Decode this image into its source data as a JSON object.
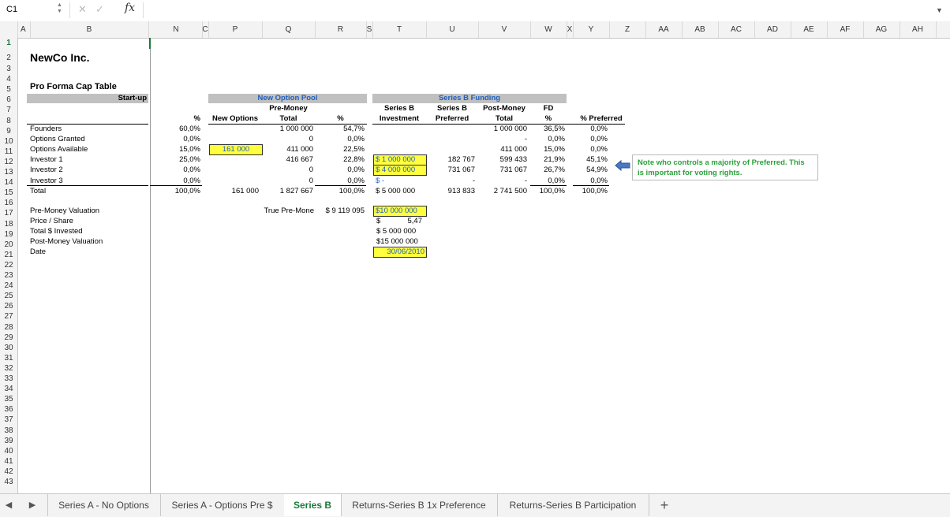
{
  "formula_bar": {
    "name_box": "C1",
    "fx": "fx",
    "formula": ""
  },
  "columns": [
    "A",
    "B",
    "N",
    "C",
    "P",
    "Q",
    "R",
    "S",
    "T",
    "U",
    "V",
    "W",
    "X",
    "Y",
    "Z",
    "AA",
    "AB",
    "AC",
    "AD",
    "AE",
    "AF",
    "AG",
    "AH"
  ],
  "rows": [
    "1",
    "2",
    "3",
    "4",
    "5",
    "6",
    "7",
    "8",
    "9",
    "10",
    "11",
    "12",
    "13",
    "14",
    "15",
    "16",
    "17",
    "18",
    "19",
    "20",
    "21",
    "22",
    "23",
    "24",
    "25",
    "26",
    "27",
    "28",
    "29",
    "30",
    "31",
    "32",
    "33",
    "34",
    "35",
    "36",
    "37",
    "38",
    "39",
    "40",
    "41",
    "42",
    "43"
  ],
  "sheet": {
    "company": "NewCo Inc.",
    "subtitle": "Pro Forma Cap Table",
    "startup_header": "Start-up",
    "new_option_pool_header": "New Option Pool",
    "series_b_funding_header": "Series B Funding",
    "hdr": {
      "pct": "%",
      "new_options": "New Options",
      "pre_money": "Pre-Money",
      "total": "Total",
      "pct2": "%",
      "series_b_1": "Series B",
      "investment": "Investment",
      "series_b_2": "Series B",
      "preferred": "Preferred",
      "post_money": "Post-Money",
      "total2": "Total",
      "fd": "FD",
      "pct3": "%",
      "pct_preferred": "% Preferred"
    },
    "table": [
      {
        "name": "Founders",
        "pct": "60,0%",
        "new_opt": "",
        "pre_total": "1 000 000",
        "pct2": "54,7%",
        "inv": "",
        "pref": "",
        "post": "1 000 000",
        "fd": "36,5%",
        "pp": "0,0%"
      },
      {
        "name": "Options Granted",
        "pct": "0,0%",
        "new_opt": "",
        "pre_total": "0",
        "pct2": "0,0%",
        "inv": "",
        "pref": "",
        "post": "-",
        "fd": "0,0%",
        "pp": "0,0%"
      },
      {
        "name": "Options Available",
        "pct": "15,0%",
        "new_opt": "161 000",
        "pre_total": "411 000",
        "pct2": "22,5%",
        "inv": "",
        "pref": "",
        "post": "411 000",
        "fd": "15,0%",
        "pp": "0,0%"
      },
      {
        "name": "Investor 1",
        "pct": "25,0%",
        "new_opt": "",
        "pre_total": "416 667",
        "pct2": "22,8%",
        "inv": "$  1 000 000",
        "pref": "182 767",
        "post": "599 433",
        "fd": "21,9%",
        "pp": "45,1%"
      },
      {
        "name": "Investor 2",
        "pct": "0,0%",
        "new_opt": "",
        "pre_total": "0",
        "pct2": "0,0%",
        "inv": "$  4 000 000",
        "pref": "731 067",
        "post": "731 067",
        "fd": "26,7%",
        "pp": "54,9%"
      },
      {
        "name": "Investor 3",
        "pct": "0,0%",
        "new_opt": "",
        "pre_total": "0",
        "pct2": "0,0%",
        "inv": "$            -",
        "pref": "-",
        "post": "-",
        "fd": "0,0%",
        "pp": "0,0%"
      },
      {
        "name": "Total",
        "pct": "100,0%",
        "new_opt": "161 000",
        "pre_total": "1 827 667",
        "pct2": "100,0%",
        "inv": "$  5 000 000",
        "pref": "913 833",
        "post": "2 741 500",
        "fd": "100,0%",
        "pp": "100,0%"
      }
    ],
    "valuation": {
      "labels": [
        "Pre-Money Valuation",
        "Price / Share",
        "Total $ Invested",
        "Post-Money Valuation",
        "Date"
      ],
      "true_pre_label": "True Pre-Mone",
      "true_pre_value": "$  9 119 095",
      "pre_money": "$10 000 000",
      "price_dollar": "$",
      "price_value": "5,47",
      "total_invested": "$  5 000 000",
      "post_money": "$15 000 000",
      "date": "30/06/2010"
    },
    "note": "Note who controls a majority of Preferred.  This is important for voting rights."
  },
  "tabs": [
    {
      "label": "Series A - No Options",
      "active": false
    },
    {
      "label": "Series A - Options Pre $",
      "active": false
    },
    {
      "label": "Series B",
      "active": true
    },
    {
      "label": "Returns-Series B 1x Preference",
      "active": false
    },
    {
      "label": "Returns-Series B Participation",
      "active": false
    }
  ],
  "add_sheet": "+",
  "colors": {
    "accent_green": "#1a7a3a",
    "highlight_yellow": "#ffff40",
    "header_blue": "#1f5fbf",
    "note_green": "#2aa23a"
  }
}
